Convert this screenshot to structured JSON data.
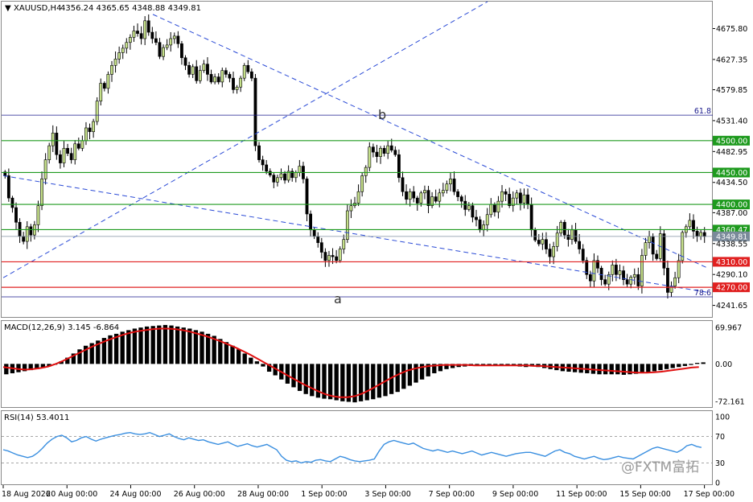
{
  "header": {
    "symbol": "XAUUSD,H4",
    "ohlc": "4356.24 4365.65 4348.88 4349.81"
  },
  "watermark": "@FXTM富拓",
  "colors": {
    "bull": "#c5e08a",
    "bear": "#000000",
    "wick": "#000000",
    "trendline": "#2b4bd6",
    "support_green": "#1e9a1e",
    "support_red": "#e02020",
    "fib": "#1a1a8c",
    "macd_signal": "#e01010",
    "rsi_line": "#3a8fe0",
    "grid_text": "#000000"
  },
  "chart_data": [
    {
      "type": "candlestick",
      "panel": "price",
      "symbol": "XAUUSD",
      "timeframe": "H4",
      "y_ticks": [
        "4675.80",
        "4627.35",
        "4579.85",
        "4531.40",
        "4482.95",
        "4434.50",
        "4387.00",
        "4338.55",
        "4290.10",
        "4241.65"
      ],
      "ylim": [
        4226,
        4713
      ],
      "x_ticks": [
        "18 Aug 2026",
        "20 Aug 00:00",
        "24 Aug 00:00",
        "26 Aug 00:00",
        "28 Aug 00:00",
        "1 Sep 00:00",
        "3 Sep 00:00",
        "7 Sep 00:00",
        "9 Sep 00:00",
        "11 Sep 00:00",
        "15 Sep 00:00",
        "17 Sep 00:00"
      ],
      "closes": [
        4445,
        4410,
        4395,
        4372,
        4350,
        4342,
        4365,
        4352,
        4368,
        4398,
        4440,
        4470,
        4492,
        4512,
        4478,
        4465,
        4488,
        4480,
        4470,
        4495,
        4488,
        4500,
        4520,
        4514,
        4530,
        4562,
        4590,
        4582,
        4604,
        4618,
        4628,
        4638,
        4645,
        4654,
        4662,
        4672,
        4668,
        4660,
        4688,
        4670,
        4660,
        4654,
        4632,
        4646,
        4650,
        4660,
        4664,
        4652,
        4630,
        4618,
        4604,
        4616,
        4594,
        4610,
        4620,
        4604,
        4592,
        4600,
        4592,
        4610,
        4604,
        4598,
        4580,
        4584,
        4598,
        4618,
        4608,
        4598,
        4492,
        4470,
        4462,
        4452,
        4446,
        4435,
        4442,
        4448,
        4438,
        4452,
        4442,
        4450,
        4460,
        4440,
        4385,
        4360,
        4350,
        4340,
        4325,
        4312,
        4320,
        4318,
        4312,
        4330,
        4345,
        4390,
        4398,
        4402,
        4420,
        4445,
        4458,
        4490,
        4482,
        4475,
        4488,
        4480,
        4492,
        4485,
        4478,
        4442,
        4420,
        4408,
        4420,
        4410,
        4402,
        4418,
        4422,
        4398,
        4412,
        4405,
        4418,
        4422,
        4432,
        4440,
        4420,
        4412,
        4405,
        4392,
        4398,
        4380,
        4376,
        4360,
        4368,
        4384,
        4400,
        4388,
        4405,
        4420,
        4416,
        4398,
        4410,
        4418,
        4402,
        4415,
        4400,
        4360,
        4344,
        4338,
        4345,
        4330,
        4318,
        4334,
        4355,
        4372,
        4352,
        4345,
        4360,
        4342,
        4330,
        4312,
        4290,
        4280,
        4312,
        4300,
        4282,
        4275,
        4290,
        4305,
        4290,
        4296,
        4282,
        4275,
        4286,
        4290,
        4272,
        4320,
        4340,
        4350,
        4322,
        4315,
        4354,
        4300,
        4262,
        4272,
        4285,
        4312,
        4356,
        4365,
        4375,
        4358,
        4350,
        4356,
        4349.81
      ],
      "horizontal_levels": [
        {
          "label": "4500.00",
          "value": 4500,
          "kind": "green"
        },
        {
          "label": "4450.00",
          "value": 4450,
          "kind": "green"
        },
        {
          "label": "4400.00",
          "value": 4400,
          "kind": "green"
        },
        {
          "label": "4360.47",
          "value": 4360.47,
          "kind": "green"
        },
        {
          "label": "4349.81",
          "value": 4349.81,
          "kind": "current"
        },
        {
          "label": "4310.00",
          "value": 4310,
          "kind": "red"
        },
        {
          "label": "4270.00",
          "value": 4270,
          "kind": "red"
        }
      ],
      "fib_levels": [
        {
          "label": "61.8",
          "value": 4540
        },
        {
          "label": "78.6",
          "value": 4255
        }
      ],
      "annotations": [
        "a",
        "b"
      ]
    },
    {
      "type": "histogram+line",
      "panel": "macd",
      "title": "MACD(12,26,9) 3.145 -6.864",
      "y_ticks": [
        "69.967",
        "0.00",
        "-72.161"
      ],
      "ylim": [
        -80,
        78
      ],
      "histogram": [
        -20,
        -18,
        -16,
        -14,
        -12,
        -10,
        -8,
        -5,
        0,
        5,
        12,
        20,
        28,
        35,
        40,
        45,
        50,
        55,
        58,
        62,
        65,
        68,
        70,
        72,
        73,
        74,
        75,
        74,
        72,
        70,
        68,
        65,
        62,
        58,
        54,
        48,
        42,
        35,
        28,
        20,
        12,
        5,
        -5,
        -15,
        -22,
        -30,
        -38,
        -45,
        -52,
        -58,
        -62,
        -65,
        -67,
        -68,
        -70,
        -72,
        -73,
        -74,
        -72,
        -70,
        -68,
        -65,
        -62,
        -58,
        -54,
        -48,
        -42,
        -36,
        -30,
        -24,
        -18,
        -14,
        -10,
        -8,
        -6,
        -5,
        -4,
        -3,
        -2,
        -3,
        -2,
        -4,
        -3,
        -4,
        -5,
        -6,
        -5,
        -6,
        -8,
        -10,
        -12,
        -14,
        -15,
        -16,
        -17,
        -18,
        -19,
        -20,
        -20,
        -20,
        -20,
        -21,
        -20,
        -19,
        -18,
        -16,
        -14,
        -12,
        -10,
        -8,
        -6,
        -4,
        -2,
        2,
        3
      ],
      "signal": [
        -6,
        -8,
        -10,
        -11,
        -10,
        -8,
        -5,
        0,
        6,
        13,
        20,
        27,
        34,
        40,
        46,
        51,
        56,
        60,
        63,
        65,
        67,
        68,
        68,
        67,
        65,
        62,
        58,
        54,
        49,
        44,
        38,
        32,
        25,
        18,
        10,
        2,
        -6,
        -14,
        -22,
        -30,
        -38,
        -45,
        -52,
        -58,
        -62,
        -64,
        -64,
        -62,
        -57,
        -50,
        -42,
        -34,
        -26,
        -19,
        -13,
        -9,
        -6,
        -4,
        -3,
        -2,
        -2,
        -2,
        -2,
        -3,
        -3,
        -3,
        -3,
        -3,
        -3,
        -3,
        -3,
        -4,
        -4,
        -5,
        -6,
        -7,
        -8,
        -9,
        -10,
        -11,
        -12,
        -13,
        -14,
        -15,
        -16,
        -17,
        -17,
        -16,
        -15,
        -13,
        -11,
        -9,
        -7,
        -6
      ]
    },
    {
      "type": "line",
      "panel": "rsi",
      "title": "RSI(14) 53.4011",
      "y_ticks": [
        "100",
        "70",
        "30",
        "0"
      ],
      "ylim": [
        0,
        100
      ],
      "levels": [
        70,
        30
      ],
      "values": [
        50,
        48,
        45,
        42,
        40,
        38,
        40,
        45,
        52,
        60,
        66,
        70,
        72,
        68,
        62,
        64,
        68,
        70,
        66,
        63,
        66,
        68,
        70,
        72,
        73,
        75,
        76,
        74,
        73,
        74,
        76,
        73,
        70,
        72,
        74,
        70,
        67,
        65,
        68,
        66,
        64,
        65,
        62,
        60,
        58,
        60,
        62,
        58,
        55,
        57,
        59,
        56,
        54,
        56,
        58,
        54,
        50,
        40,
        34,
        32,
        33,
        30,
        32,
        31,
        34,
        35,
        33,
        32,
        36,
        40,
        38,
        35,
        33,
        32,
        33,
        34,
        36,
        48,
        58,
        62,
        64,
        62,
        60,
        58,
        60,
        56,
        52,
        50,
        48,
        50,
        48,
        46,
        48,
        46,
        44,
        46,
        48,
        45,
        42,
        44,
        46,
        44,
        42,
        40,
        42,
        44,
        45,
        46,
        46,
        44,
        42,
        40,
        44,
        48,
        50,
        46,
        44,
        40,
        38,
        36,
        38,
        40,
        37,
        35,
        36,
        38,
        40,
        38,
        37,
        36,
        40,
        44,
        48,
        52,
        54,
        52,
        50,
        48,
        46,
        50,
        56,
        58,
        55,
        53.4
      ]
    }
  ]
}
